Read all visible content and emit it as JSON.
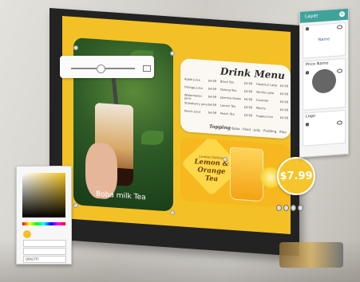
{
  "photo": {
    "caption": "Boba milk Tea"
  },
  "menu": {
    "title": "Drink Menu",
    "col1": [
      {
        "name": "Apple juice",
        "price": "$4.99"
      },
      {
        "name": "Orange juice",
        "price": "$4.99"
      },
      {
        "name": "Watermelon juice",
        "price": "$4.99"
      },
      {
        "name": "Strawberry juice",
        "price": "$4.99"
      },
      {
        "name": "Peach juice",
        "price": "$4.99"
      }
    ],
    "col2": [
      {
        "name": "Black Tea",
        "price": "$4.99"
      },
      {
        "name": "Oolong Tea",
        "price": "$4.99"
      },
      {
        "name": "Jasmine Green",
        "price": "$4.99"
      },
      {
        "name": "Lemon Tea",
        "price": "$4.99"
      },
      {
        "name": "Peach Tea",
        "price": "$4.99"
      }
    ],
    "col3": [
      {
        "name": "Hazelnut Latte",
        "price": "$4.99"
      },
      {
        "name": "Vanilla Latte",
        "price": "$4.99"
      },
      {
        "name": "Caramel",
        "price": "$4.99"
      },
      {
        "name": "Mocha",
        "price": "$4.99"
      },
      {
        "name": "Cappuccino",
        "price": "$4.99"
      }
    ],
    "topping_label": "Topping",
    "toppings": "Boba · Pearl · Jelly · Pudding · Aloe"
  },
  "promo": {
    "tag": "Limited Edition",
    "name": "Lemon & Orange Tea"
  },
  "price": "$7.99",
  "picker": {
    "fields": [
      "",
      "",
      ""
    ],
    "labels": [
      "",
      "",
      "OPACITY"
    ]
  },
  "layers": {
    "title": "Layer",
    "items": [
      {
        "label": "Name"
      },
      {
        "label": "Price Name"
      },
      {
        "label": "Logo"
      }
    ]
  }
}
